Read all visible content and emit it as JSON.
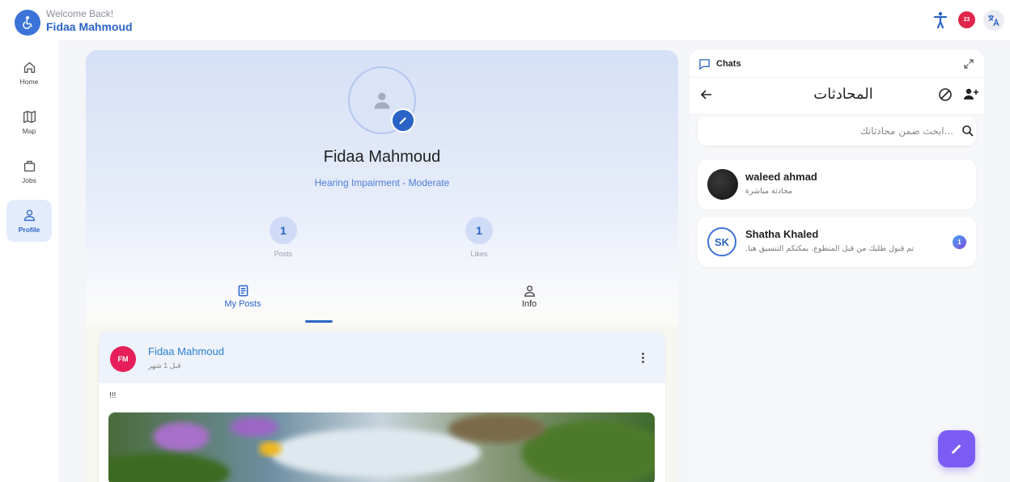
{
  "header": {
    "logo_icon": "wheelchair-icon",
    "welcome_text": "Welcome Back!",
    "user_name": "Fidaa Mahmoud",
    "notification_count": "23",
    "accessibility_icon": "accessibility-person-icon",
    "language_icon": "translate-icon"
  },
  "sidebar": {
    "items": [
      {
        "label": "Home",
        "icon": "home-icon",
        "active": false
      },
      {
        "label": "Map",
        "icon": "map-icon",
        "active": false
      },
      {
        "label": "Jobs",
        "icon": "briefcase-icon",
        "active": false
      },
      {
        "label": "Profile",
        "icon": "profile-icon",
        "active": true
      }
    ]
  },
  "profile": {
    "name": "Fidaa Mahmoud",
    "condition": "Hearing Impairment - Moderate",
    "stats": [
      {
        "value": "1",
        "label": "Posts"
      },
      {
        "value": "1",
        "label": "Likes"
      }
    ],
    "tabs": [
      {
        "label": "My Posts",
        "active": true
      },
      {
        "label": "Info",
        "active": false
      }
    ]
  },
  "post": {
    "avatar_initials": "FM",
    "author": "Fidaa Mahmoud",
    "time": "قبل 1 شهر",
    "text": "!!!"
  },
  "chats": {
    "panel_title": "Chats",
    "title": "المحادثات",
    "search_placeholder": "...ابحث ضمن محادثاتك",
    "items": [
      {
        "name": "waleed ahmad",
        "preview": "محادثة مباشرة",
        "avatar_type": "photo"
      },
      {
        "name": "Shatha Khaled",
        "preview": ".تم قبول طلبك من قبل المتطوع. يمكنكم التنسيق هنا",
        "avatar_initials": "SK",
        "unread": "1"
      }
    ]
  },
  "colors": {
    "primary": "#2b64c6",
    "badge": "#e0254a",
    "fab": "#7b5df5",
    "post_avatar": "#e61f5b"
  }
}
